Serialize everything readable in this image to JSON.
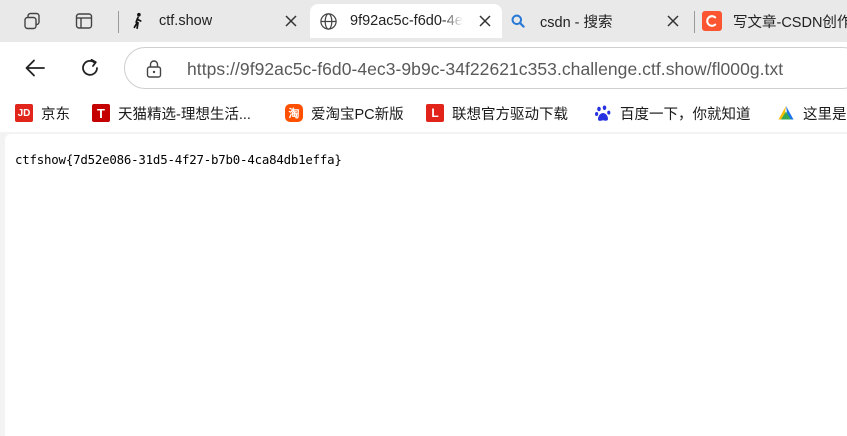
{
  "tabs": [
    {
      "label": "ctf.show",
      "icon": "walking-figure-icon",
      "active": false
    },
    {
      "label": "9f92ac5c-f6d0-4e",
      "icon": "globe-icon",
      "active": true
    },
    {
      "label": "csdn - 搜索",
      "icon": "search-icon",
      "active": false
    },
    {
      "label": "写文章-CSDN创作",
      "icon": "csdn-c-icon",
      "active": false
    }
  ],
  "address_bar": {
    "url": "https://9f92ac5c-f6d0-4ec3-9b9c-34f22621c353.challenge.ctf.show/fl000g.txt"
  },
  "bookmarks": [
    {
      "label": "京东",
      "icon_text": "JD",
      "color": "#e1251b"
    },
    {
      "label": "天猫精选-理想生活...",
      "icon_text": "T",
      "color": "#c40000"
    },
    {
      "label": "爱淘宝PC新版",
      "icon_text": "淘",
      "color": "#ff5000"
    },
    {
      "label": "联想官方驱动下载",
      "icon_text": "L",
      "color": "#e2231a"
    },
    {
      "label": "百度一下，你就知道",
      "icon_text": "",
      "color": "#2932e1"
    },
    {
      "label": "这里是",
      "icon_text": "",
      "color": "#1a73e8"
    }
  ],
  "page": {
    "text": "ctfshow{7d52e086-31d5-4f27-b7b0-4ca84db1effa}"
  }
}
